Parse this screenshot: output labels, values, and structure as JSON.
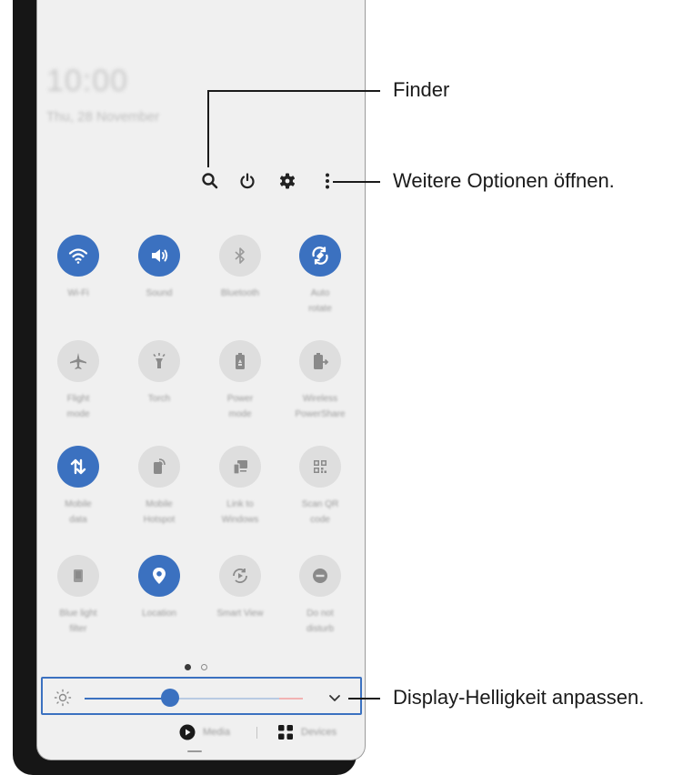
{
  "lockscreen": {
    "time": "10:00",
    "date": "Thu, 28 November"
  },
  "toolbar": {
    "search_icon": "search-icon",
    "power_icon": "power-icon",
    "settings_icon": "gear-icon",
    "more_icon": "more-vertical-icon"
  },
  "accent_color": "#3b71c0",
  "tiles": [
    {
      "label": "Wi-Fi",
      "icon": "wifi-icon",
      "state": "on"
    },
    {
      "label": "Sound",
      "icon": "speaker-icon",
      "state": "on"
    },
    {
      "label": "Bluetooth",
      "icon": "bluetooth-icon",
      "state": "off"
    },
    {
      "label": "Auto\nrotate",
      "icon": "rotate-icon",
      "state": "on"
    },
    {
      "label": "Flight\nmode",
      "icon": "airplane-icon",
      "state": "off"
    },
    {
      "label": "Torch",
      "icon": "flashlight-icon",
      "state": "off"
    },
    {
      "label": "Power\nmode",
      "icon": "battery-icon",
      "state": "off"
    },
    {
      "label": "Wireless\nPowerShare",
      "icon": "battery-share-icon",
      "state": "off"
    },
    {
      "label": "Mobile\ndata",
      "icon": "data-arrows-icon",
      "state": "on"
    },
    {
      "label": "Mobile\nHotspot",
      "icon": "hotspot-icon",
      "state": "off"
    },
    {
      "label": "Link to\nWindows",
      "icon": "link-windows-icon",
      "state": "off"
    },
    {
      "label": "Scan QR\ncode",
      "icon": "qr-code-icon",
      "state": "off"
    },
    {
      "label": "Blue light\nfilter",
      "icon": "blue-light-icon",
      "state": "off"
    },
    {
      "label": "Location",
      "icon": "location-pin-icon",
      "state": "on"
    },
    {
      "label": "Smart View",
      "icon": "smart-view-icon",
      "state": "off"
    },
    {
      "label": "Do not\ndisturb",
      "icon": "do-not-disturb-icon",
      "state": "off"
    }
  ],
  "pagination": {
    "current": 1,
    "total": 2
  },
  "brightness": {
    "level": 0.39,
    "icon": "sun-icon",
    "expand_icon": "chevron-down-icon"
  },
  "bottom_bar": {
    "media_label": "Media",
    "devices_label": "Devices"
  },
  "callouts": {
    "finder": "Finder",
    "more_options": "Weitere Optionen öffnen.",
    "brightness": "Display-Helligkeit anpassen."
  }
}
